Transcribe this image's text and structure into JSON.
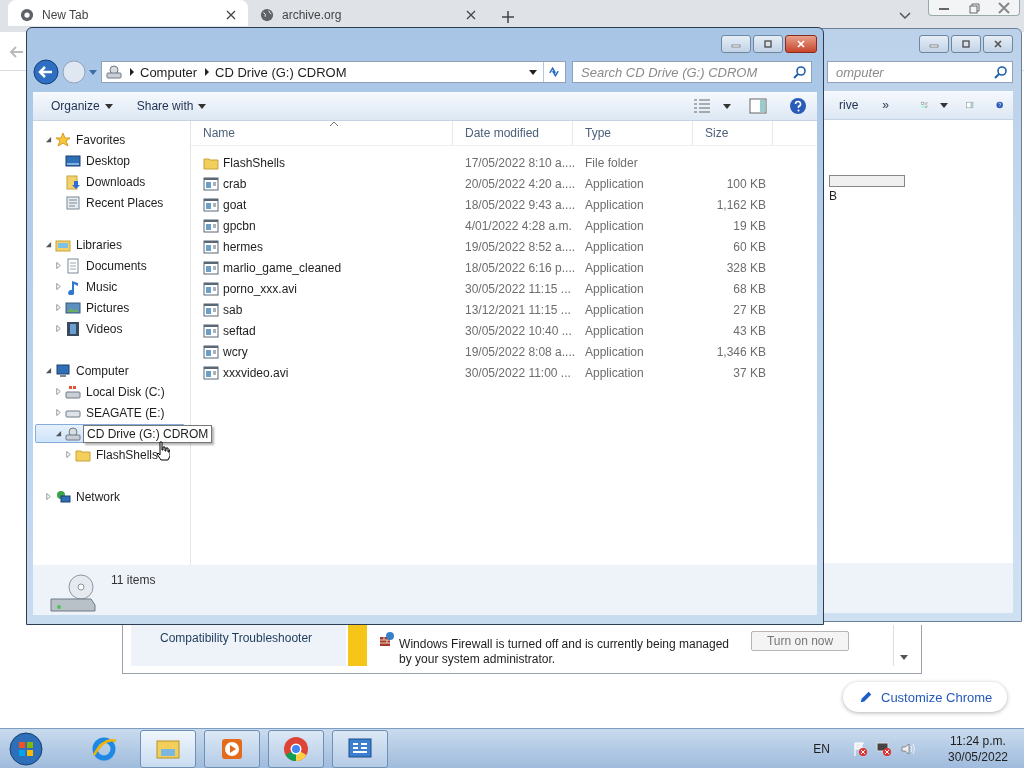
{
  "browser": {
    "tabs": [
      {
        "title": "New Tab",
        "selected": true
      },
      {
        "title": "archive.org",
        "selected": false
      }
    ]
  },
  "back_window": {
    "search_placeholder": "omputer",
    "toolbar_label": "rive",
    "overflow": "»",
    "size_text": "B"
  },
  "explorer": {
    "breadcrumbs": [
      "Computer",
      "CD Drive (G:) CDROM"
    ],
    "search_placeholder": "Search CD Drive (G:) CDROM",
    "toolbar": [
      "Organize",
      "Share with"
    ],
    "tree": [
      {
        "label": "Favorites",
        "kind": "star",
        "expanded": true,
        "selected": false,
        "children": [
          {
            "label": "Desktop",
            "kind": "desktop",
            "selected": false
          },
          {
            "label": "Downloads",
            "kind": "downloads",
            "selected": false
          },
          {
            "label": "Recent Places",
            "kind": "recent",
            "selected": false
          }
        ]
      },
      {
        "label": "Libraries",
        "kind": "library",
        "expanded": true,
        "selected": false,
        "children": [
          {
            "label": "Documents",
            "kind": "document",
            "expanded": false,
            "selected": false
          },
          {
            "label": "Music",
            "kind": "music",
            "expanded": false,
            "selected": false
          },
          {
            "label": "Pictures",
            "kind": "picture",
            "expanded": false,
            "selected": false
          },
          {
            "label": "Videos",
            "kind": "video",
            "expanded": false,
            "selected": false
          }
        ]
      },
      {
        "label": "Computer",
        "kind": "computer",
        "expanded": true,
        "selected": false,
        "children": [
          {
            "label": "Local Disk (C:)",
            "kind": "disk",
            "expanded": false,
            "selected": false
          },
          {
            "label": "SEAGATE (E:)",
            "kind": "drive",
            "expanded": false,
            "selected": false
          },
          {
            "label": "CD Drive (G:) CDROM",
            "kind": "cd",
            "expanded": true,
            "selected": true,
            "children": [
              {
                "label": "FlashShells",
                "kind": "folder",
                "expanded": false,
                "selected": false
              }
            ]
          }
        ]
      },
      {
        "label": "Network",
        "kind": "network",
        "expanded": false,
        "selected": false
      }
    ],
    "columns": [
      "Name",
      "Date modified",
      "Type",
      "Size"
    ],
    "files": [
      {
        "name": "FlashShells",
        "kind": "folder",
        "date": "17/05/2022 8:10 a....",
        "type": "File folder"
      },
      {
        "name": "crab",
        "kind": "app",
        "date": "20/05/2022 4:20 a....",
        "type": "Application",
        "size": "100 KB"
      },
      {
        "name": "goat",
        "kind": "app",
        "date": "18/05/2022 9:43 a....",
        "type": "Application",
        "size": "1,162 KB"
      },
      {
        "name": "gpcbn",
        "kind": "app",
        "date": "4/01/2022 4:28 a.m.",
        "type": "Application",
        "size": "19 KB"
      },
      {
        "name": "hermes",
        "kind": "app",
        "date": "19/05/2022 8:52 a....",
        "type": "Application",
        "size": "60 KB"
      },
      {
        "name": "marlio_game_cleaned",
        "kind": "app",
        "date": "18/05/2022 6:16 p....",
        "type": "Application",
        "size": "328 KB"
      },
      {
        "name": "porno_xxx.avi",
        "kind": "app",
        "date": "30/05/2022 11:15 ...",
        "type": "Application",
        "size": "68 KB"
      },
      {
        "name": "sab",
        "kind": "app",
        "date": "13/12/2021 11:15 ...",
        "type": "Application",
        "size": "27 KB"
      },
      {
        "name": "seftad",
        "kind": "app",
        "date": "30/05/2022 10:40 ...",
        "type": "Application",
        "size": "43 KB"
      },
      {
        "name": "wcry",
        "kind": "app",
        "date": "19/05/2022 8:08 a....",
        "type": "Application",
        "size": "1,346 KB"
      },
      {
        "name": "xxxvideo.avi",
        "kind": "app",
        "date": "30/05/2022 11:00 ...",
        "type": "Application",
        "size": "37 KB"
      }
    ],
    "status": "11 items"
  },
  "control_panel": {
    "left_lines": [
      "Compatibility Troubleshooter"
    ],
    "message": "Windows Firewall is turned off and is currently being managed by your system administrator.",
    "button": "Turn on now"
  },
  "customize_button": "Customize Chrome",
  "taskbar": {
    "apps": [
      {
        "kind": "ie",
        "running": false,
        "selected": false
      },
      {
        "kind": "explorer",
        "running": true,
        "selected": true
      },
      {
        "kind": "media",
        "running": true,
        "selected": false
      },
      {
        "kind": "chrome",
        "running": true,
        "selected": false
      },
      {
        "kind": "control",
        "running": true,
        "selected": false
      }
    ],
    "language": "EN",
    "time": "11:24 p.m.",
    "date": "30/05/2022"
  }
}
